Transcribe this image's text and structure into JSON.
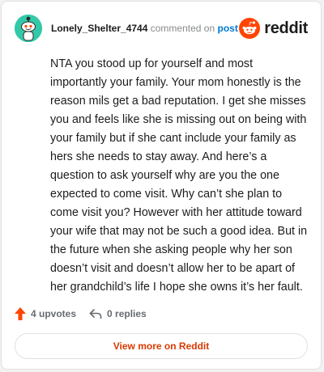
{
  "header": {
    "username": "Lonely_Shelter_4744",
    "commented_text": "commented on",
    "post_link": "post",
    "brand": "reddit"
  },
  "comment": {
    "body": "NTA you stood up for yourself and most importantly your family. Your mom honestly is the reason mils get a bad reputation. I get she misses you and feels like she is missing out on being with your family but if she cant include your family as hers she needs to stay away. And here’s a question to ask yourself why are you the one expected to come visit. Why can’t she plan to come visit you? However with her attitude toward your wife that may not be such a good idea. But in the future when she asking people why her son doesn’t visit and doesn’t allow her to be apart of her grandchild’s life I hope she owns it’s her fault."
  },
  "actions": {
    "upvotes": "4 upvotes",
    "replies": "0 replies"
  },
  "footer": {
    "view_more": "View more on Reddit"
  },
  "colors": {
    "upvote": "#ff4500",
    "link": "#0079d3",
    "view_more": "#d93a00",
    "avatar_bg": "#33c9a8"
  }
}
